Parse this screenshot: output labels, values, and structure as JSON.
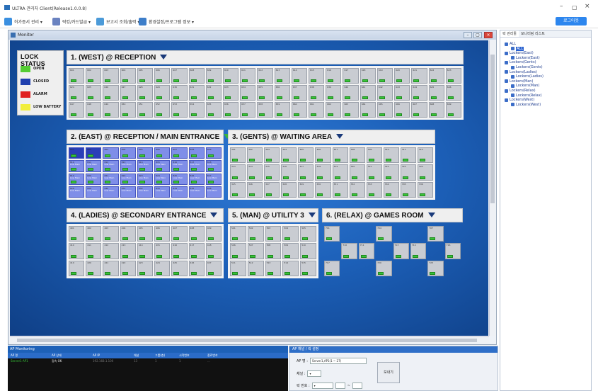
{
  "window": {
    "title": "ULTRA 관리자 Client(Release1.0.0.8)",
    "min_glyph": "–",
    "max_glyph": "▢",
    "close_glyph": "×"
  },
  "menubar": {
    "items": [
      {
        "label": "허가증서 관리 ▾",
        "icon": "key-card-icon",
        "color": "#3a8fe0"
      },
      {
        "label": "락킹/카드발급 ▾",
        "icon": "lock-card-icon",
        "color": "#6a82c0"
      },
      {
        "label": "보고서 조회/출력 ▾",
        "icon": "report-icon",
        "color": "#4b9ad8"
      },
      {
        "label": "환경설정/프로그램 정보 ▾",
        "icon": "settings-user-icon",
        "color": "#3d7ec9"
      }
    ],
    "login_label": "로그아웃"
  },
  "monitor": {
    "title": "Monitor",
    "legend": {
      "title": "LOCK STATUS",
      "items": [
        {
          "label": "OPEN",
          "color": "#55cc33"
        },
        {
          "label": "CLOSED",
          "color": "#1f3fae"
        },
        {
          "label": "ALARM",
          "color": "#e02020"
        },
        {
          "label": "LOW BATTERY",
          "color": "#f1ee3d"
        }
      ]
    },
    "zones": [
      {
        "id": "west",
        "title": "1. (WEST) @ RECEPTION",
        "icon": "wifi-signal-icon",
        "icon_color": "navy",
        "cols": 23,
        "rows": 3,
        "start": 601,
        "style": "grey"
      },
      {
        "id": "east",
        "title": "2. (EAST) @ RECEPTION / MAIN ENTRANCE",
        "icon": "wifi-signal-icon",
        "icon_color": "green",
        "cols": 9,
        "rows": 4,
        "start": 801,
        "style": "blue",
        "cell_text": "Low Main"
      },
      {
        "id": "gents",
        "title": "3. (GENTS) @ WAITING AREA",
        "icon": "wifi-signal-icon",
        "icon_color": "navy",
        "cols": 12,
        "rows": 3,
        "start": 301,
        "style": "grey"
      },
      {
        "id": "ladies",
        "title": "4. (LADIES) @ SECONDARY ENTRANCE",
        "icon": "wifi-signal-icon",
        "icon_color": "navy",
        "cols": 9,
        "rows": 3,
        "start": 401,
        "style": "grey"
      },
      {
        "id": "man",
        "title": "5. (MAN) @ UTILITY 3",
        "icon": "wifi-signal-icon",
        "icon_color": "navy",
        "cols": 5,
        "rows": 3,
        "start": 501,
        "style": "grey"
      },
      {
        "id": "relax",
        "title": "6. (RELAX) @ GAMES ROOM",
        "icon": "wifi-signal-icon",
        "icon_color": "navy",
        "cols": 8,
        "rows": 3,
        "start": 701,
        "style": "relax"
      }
    ]
  },
  "ap_monitoring": {
    "title": "AP Monitoring",
    "columns": [
      "AP 명",
      "AP 상태",
      "AP IP",
      "채널",
      "그룹(층)",
      "시작번호",
      "종료번호"
    ],
    "rows": [
      [
        "Server1 AP1",
        "접속 OK",
        "192.168.1.100",
        "13",
        "1",
        "1",
        "..."
      ]
    ]
  },
  "ap_settings": {
    "title": "AP 채널 / 락 설정",
    "ap_name_label": "AP 명 :",
    "ap_name_value": "Server1,AP1(1 ~ 27)",
    "channel_label": "채널 :",
    "lock_number_label": "락 번호 :",
    "range_sep": "~",
    "view_button": "보내기"
  },
  "tree": {
    "tabs": [
      "락 관리툴",
      "모니터링 리스트"
    ],
    "nodes": [
      {
        "label": "ALL",
        "depth": 0
      },
      {
        "label": "ALL",
        "depth": 1,
        "selected": true
      },
      {
        "label": "Lockers(East)",
        "depth": 0
      },
      {
        "label": "Lockers(East)",
        "depth": 1
      },
      {
        "label": "Lockers(Gents)",
        "depth": 0
      },
      {
        "label": "Lockers(Gents)",
        "depth": 1
      },
      {
        "label": "Lockers(Ladies)",
        "depth": 0
      },
      {
        "label": "Lockers(Ladies)",
        "depth": 1
      },
      {
        "label": "Lockers(Man)",
        "depth": 0
      },
      {
        "label": "Lockers(Man)",
        "depth": 1
      },
      {
        "label": "Lockers(Relax)",
        "depth": 0
      },
      {
        "label": "Lockers(Relax)",
        "depth": 1
      },
      {
        "label": "Lockers(West)",
        "depth": 0
      },
      {
        "label": "Lockers(West)",
        "depth": 1
      }
    ]
  }
}
